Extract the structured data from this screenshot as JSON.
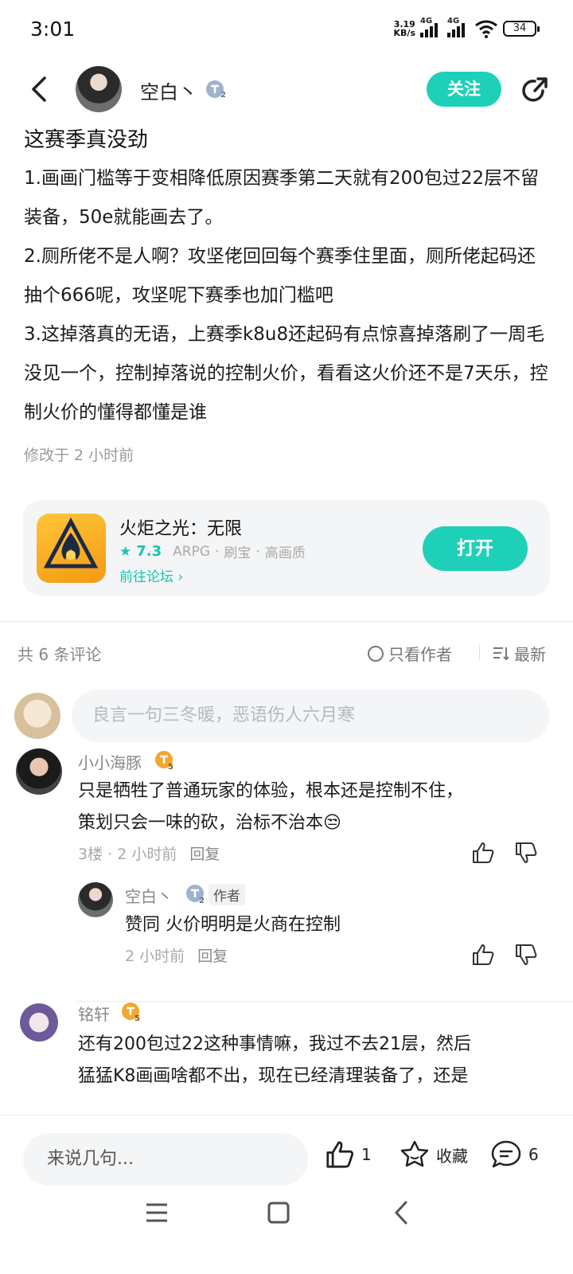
{
  "status_bar": {
    "time": "3:01",
    "net_speed_value": "3.19",
    "net_speed_unit": "KB/s",
    "signal1_label": "4G",
    "signal2_label": "4G",
    "battery": "34"
  },
  "header": {
    "author": "空白丶",
    "level": "2",
    "follow_label": "关注"
  },
  "post": {
    "title": "这赛季真没劲",
    "paragraphs": [
      "1.画画门槛等于变相降低原因赛季第二天就有200包过22层不留装备，50e就能画去了。",
      "2.厕所佬不是人啊？攻坚佬回回每个赛季住里面，厕所佬起码还抽个666呢，攻坚呢下赛季也加门槛吧",
      "3.这掉落真的无语，上赛季k8u8还起码有点惊喜掉落刷了一周毛没见一个，控制掉落说的控制火价，看看这火价还不是7天乐，控制火价的懂得都懂是谁"
    ],
    "modified": "修改于 2 小时前"
  },
  "game_card": {
    "name": "火炬之光：无限",
    "rating": "7.3",
    "tags": [
      "ARPG",
      "刷宝",
      "高画质"
    ],
    "forum_link": "前往论坛",
    "open_label": "打开"
  },
  "comments_header": {
    "count": "共 6 条评论",
    "only_author": "只看作者",
    "sort": "最新"
  },
  "comment_input": {
    "placeholder": "良言一句三冬暖，恶语伤人六月寒"
  },
  "comments": [
    {
      "name": "小小海豚",
      "level": "5",
      "text_line1": "只是牺牲了普通玩家的体验，根本还是控制不住，",
      "text_line2": "策划只会一味的砍，治标不治本😒",
      "floor": "3楼",
      "time": "2 小时前",
      "reply": "回复"
    },
    {
      "name": "铭轩",
      "level": "5",
      "text_line1": "还有200包过22这种事情嘛，我过不去21层，然后",
      "text_line2": "猛猛K8画画啥都不出，现在已经清理装备了，还是"
    }
  ],
  "sub_reply": {
    "name": "空白丶",
    "level": "2",
    "author_tag": "作者",
    "text": "赞同 火价明明是火商在控制",
    "time": "2 小时前",
    "reply": "回复"
  },
  "bottom_bar": {
    "placeholder": "来说几句...",
    "likes": "1",
    "favorite_label": "收藏",
    "comments": "6"
  },
  "colors": {
    "accent": "#1fd0b9",
    "gold_badge": "#f0a830",
    "text_muted": "#9a9a9a"
  }
}
